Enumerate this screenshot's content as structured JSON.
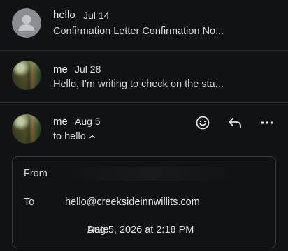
{
  "messages": [
    {
      "sender": "hello",
      "date": "Jul 14",
      "snippet": "Confirmation Letter Confirmation No..."
    },
    {
      "sender": "me",
      "date": "Jul 28",
      "snippet": "Hello, I'm writing to check on the sta..."
    },
    {
      "sender": "me",
      "date": "Aug 5",
      "to_line": "to hello",
      "details": {
        "from_label": "From",
        "from_value": "",
        "to_label": "To",
        "to_value": "hello@creeksideinnwillits.com",
        "date_label": "Date",
        "date_value": "Aug 5, 2026 at 2:18 PM"
      }
    }
  ],
  "icons": {
    "avatar_default": "person-icon",
    "emoji": "smiley-icon",
    "reply": "reply-icon",
    "more": "more-horizontal-icon",
    "caret": "chevron-up-icon"
  },
  "colors": {
    "background": "#111214",
    "divider": "#2c2d30",
    "text": "#e6e6e8",
    "border": "#3a3b3f",
    "avatar_gray": "#8b8c92"
  }
}
